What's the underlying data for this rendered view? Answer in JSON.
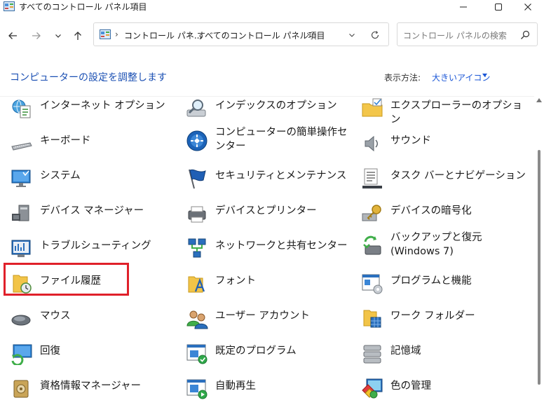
{
  "window": {
    "title": "すべてのコントロール パネル項目",
    "controls": [
      "minimize-icon",
      "maximize-icon",
      "close-icon"
    ]
  },
  "nav": {
    "back": "arrow-left-icon",
    "forward": "arrow-right-icon",
    "recent": "chevron-down-icon",
    "up": "arrow-up-icon",
    "breadcrumbs": [
      "コントロール パネ...",
      "すべてのコントロール パネル項目"
    ],
    "refresh": "refresh-icon"
  },
  "search": {
    "placeholder": "コントロール パネルの検索"
  },
  "header": {
    "title": "コンピューターの設定を調整します",
    "view_label": "表示方法:",
    "view_value": "大きいアイコン"
  },
  "items": [
    {
      "label": "インターネット オプション",
      "icon": "internet-options-icon"
    },
    {
      "label": "インデックスのオプション",
      "icon": "indexing-options-icon"
    },
    {
      "label": "エクスプローラーのオプション",
      "icon": "explorer-options-icon"
    },
    {
      "label": "キーボード",
      "icon": "keyboard-icon"
    },
    {
      "label": "コンピューターの簡単操作センター",
      "icon": "ease-of-access-icon"
    },
    {
      "label": "サウンド",
      "icon": "sound-icon"
    },
    {
      "label": "システム",
      "icon": "system-icon"
    },
    {
      "label": "セキュリティとメンテナンス",
      "icon": "security-flag-icon"
    },
    {
      "label": "タスク バーとナビゲーション",
      "icon": "taskbar-icon"
    },
    {
      "label": "デバイス マネージャー",
      "icon": "device-manager-icon"
    },
    {
      "label": "デバイスとプリンター",
      "icon": "printer-icon"
    },
    {
      "label": "デバイスの暗号化",
      "icon": "encryption-key-icon"
    },
    {
      "label": "トラブルシューティング",
      "icon": "troubleshooting-icon"
    },
    {
      "label": "ネットワークと共有センター",
      "icon": "network-icon"
    },
    {
      "label": "バックアップと復元 (Windows 7)",
      "icon": "backup-restore-icon"
    },
    {
      "label": "ファイル履歴",
      "icon": "file-history-icon"
    },
    {
      "label": "フォント",
      "icon": "fonts-icon"
    },
    {
      "label": "プログラムと機能",
      "icon": "programs-features-icon"
    },
    {
      "label": "マウス",
      "icon": "mouse-icon"
    },
    {
      "label": "ユーザー アカウント",
      "icon": "user-accounts-icon"
    },
    {
      "label": "ワーク フォルダー",
      "icon": "work-folders-icon"
    },
    {
      "label": "回復",
      "icon": "recovery-icon"
    },
    {
      "label": "既定のプログラム",
      "icon": "default-programs-icon"
    },
    {
      "label": "記憶域",
      "icon": "storage-spaces-icon"
    },
    {
      "label": "資格情報マネージャー",
      "icon": "credential-manager-icon"
    },
    {
      "label": "自動再生",
      "icon": "autoplay-icon"
    },
    {
      "label": "色の管理",
      "icon": "color-management-icon"
    }
  ],
  "colors": {
    "accent": "#1a56d6",
    "heading": "#1a4fb3",
    "highlight": "#e0202a"
  }
}
